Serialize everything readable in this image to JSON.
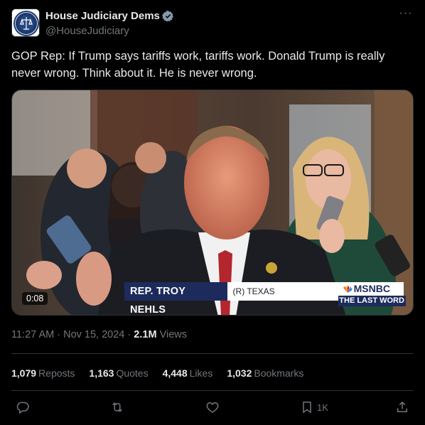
{
  "author": {
    "display_name": "House Judiciary Dems",
    "handle": "@HouseJudiciary",
    "verified": true
  },
  "tweet": {
    "text": "GOP Rep: If Trump says tariffs work, tariffs work. Donald Trump is really never wrong. Think about it. He is never wrong."
  },
  "media": {
    "type": "video",
    "duration": "0:08",
    "lower_third": {
      "name": "REP. TROY NEHLS",
      "party_state": "(R) TEXAS",
      "network": "MSNBC",
      "show": "THE LAST WORD"
    }
  },
  "meta": {
    "time": "11:27 AM",
    "separator": "·",
    "date": "Nov 15, 2024",
    "views_count": "2.1M",
    "views_label": "Views"
  },
  "stats": [
    {
      "count": "1,079",
      "label": "Reposts"
    },
    {
      "count": "1,163",
      "label": "Quotes"
    },
    {
      "count": "4,448",
      "label": "Likes"
    },
    {
      "count": "1,032",
      "label": "Bookmarks"
    }
  ],
  "actions": {
    "bookmark_count": "1K"
  },
  "colors": {
    "background": "#000000",
    "text": "#e7e9ea",
    "muted": "#71767b",
    "divider": "#2f3336",
    "verified": "#829aab",
    "msnbc_navy": "#1d2b5c"
  },
  "icons": [
    "seal-icon",
    "verified-icon",
    "more-icon",
    "reply-icon",
    "repost-icon",
    "like-icon",
    "bookmark-icon",
    "share-icon"
  ]
}
